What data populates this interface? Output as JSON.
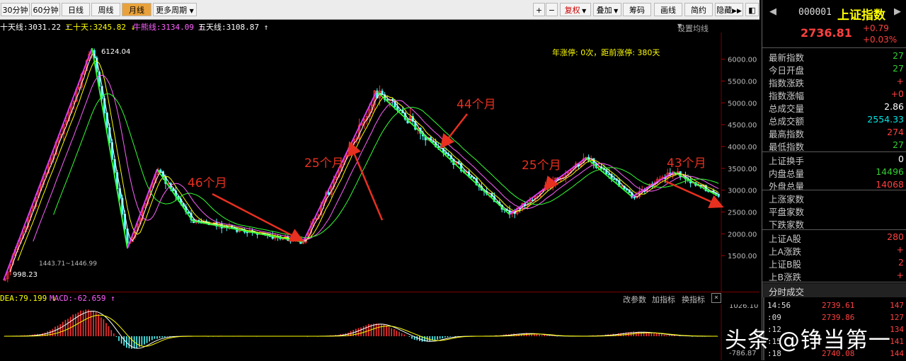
{
  "toolbar": {
    "periods": [
      "30分钟",
      "60分钟",
      "日线",
      "周线",
      "月线"
    ],
    "active_period": "月线",
    "more": "更多周期",
    "right_buttons": [
      "复权",
      "叠加",
      "筹码",
      "画线",
      "简约",
      "隐藏"
    ],
    "plus": "+",
    "minus": "−"
  },
  "ma": {
    "ma1": "十天线:3031.22 ↑",
    "ma2": "二十天:3245.82 ↓",
    "ma3": "牛熊线:3134.09 ↓",
    "ma4": "五天线:3108.87 ↑",
    "settings": "设置均线"
  },
  "chart": {
    "info": "年涨停: 0次，距前涨停: 380天",
    "high_label": "6124.04",
    "low_label": "998.23",
    "range_label": "1443.71~1446.99",
    "y_ticks": [
      "6000.00",
      "5500.00",
      "5000.00",
      "4500.00",
      "4000.00",
      "3500.00",
      "3000.00",
      "2500.00",
      "2000.00",
      "1500.00"
    ],
    "annotations": [
      "46个月",
      "25个月",
      "44个月",
      "25个月",
      "43个月"
    ]
  },
  "macd": {
    "dea": "DEA:79.199 ↓",
    "macd": "MACD:-62.659 ↑",
    "buttons": [
      "改参数",
      "加指标",
      "换指标"
    ],
    "close": "×",
    "top_tick": "1026.10",
    "bottom_tick": "-786.87"
  },
  "quote": {
    "code": "000001",
    "name": "上证指数",
    "price": "2736.81",
    "change": "+0.79",
    "change_pct": "+0.03%",
    "rows": [
      {
        "label": "最新指数",
        "value": "27",
        "cls": "green"
      },
      {
        "label": "今日开盘",
        "value": "27",
        "cls": "green"
      },
      {
        "label": "指数涨跌",
        "value": "+",
        "cls": "red-t"
      },
      {
        "label": "指数涨幅",
        "value": "+0",
        "cls": "red-t"
      },
      {
        "label": "总成交量",
        "value": "2.86",
        "cls": "white"
      },
      {
        "label": "总成交额",
        "value": "2554.33",
        "cls": "cyan"
      },
      {
        "label": "最高指数",
        "value": "274",
        "cls": "red-t"
      },
      {
        "label": "最低指数",
        "value": "27",
        "cls": "green"
      },
      {
        "label": "上证换手",
        "value": "0",
        "cls": "white"
      },
      {
        "label": "内盘总量",
        "value": "14496",
        "cls": "green"
      },
      {
        "label": "外盘总量",
        "value": "14068",
        "cls": "red-t"
      },
      {
        "label": "上涨家数",
        "value": "",
        "cls": "red-t"
      },
      {
        "label": "平盘家数",
        "value": "",
        "cls": "white"
      },
      {
        "label": "下跌家数",
        "value": "",
        "cls": "green"
      },
      {
        "label": "上证A股",
        "value": "280",
        "cls": "red-t"
      },
      {
        "label": "上A涨跌",
        "value": "+",
        "cls": "red-t"
      },
      {
        "label": "上证B股",
        "value": "2",
        "cls": "red-t"
      },
      {
        "label": "上B涨跌",
        "value": "+",
        "cls": "red-t"
      }
    ],
    "ticks_title": "分时成交",
    "ticks": [
      {
        "time": "14:56",
        "price": "2739.61",
        "vol": "147"
      },
      {
        "time": ":09",
        "price": "2739.86",
        "vol": "127"
      },
      {
        "time": ":12",
        "price": "",
        "vol": "134"
      },
      {
        "time": ":15",
        "price": "",
        "vol": "141"
      },
      {
        "time": ":18",
        "price": "2740.08",
        "vol": "144"
      }
    ]
  },
  "watermark": "头条 @铮当第一",
  "colors": {
    "up": "#ff3232",
    "down": "#54ffff",
    "zigzag_up": "#e040ff",
    "zigzag_down": "#33ff33",
    "annotation": "#e83020",
    "info": "#ffff00"
  }
}
